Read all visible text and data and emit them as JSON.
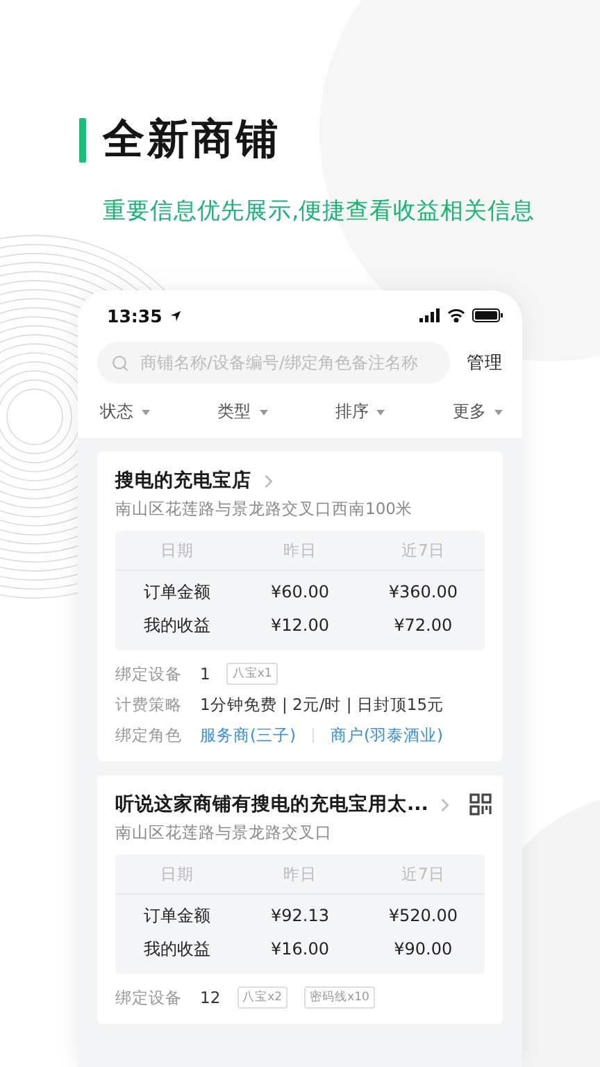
{
  "headline": {
    "title": "全新商铺",
    "subtitle": "重要信息优先展示,便捷查看收益相关信息"
  },
  "phone": {
    "status_bar": {
      "time": "13:35"
    },
    "search": {
      "placeholder": "商铺名称/设备编号/绑定角色备注名称"
    },
    "manage_button": "管理",
    "filters": [
      "状态",
      "类型",
      "排序",
      "更多"
    ],
    "stores": [
      {
        "name": "搜电的充电宝店",
        "qr_code": false,
        "address": "南山区花莲路与景龙路交叉口西南100米",
        "table": {
          "columns": [
            "日期",
            "昨日",
            "近7日"
          ],
          "rows": [
            [
              "订单金额",
              "¥60.00",
              "¥360.00"
            ],
            [
              "我的收益",
              "¥12.00",
              "¥72.00"
            ]
          ]
        },
        "details": [
          {
            "kind": "devices",
            "label": "绑定设备",
            "value": "1",
            "tags": [
              "八宝x1"
            ]
          },
          {
            "kind": "text",
            "label": "计费策略",
            "value": "1分钟免费 | 2元/时 | 日封顶15元"
          },
          {
            "kind": "roles",
            "label": "绑定角色",
            "links": [
              "服务商(三子)",
              "商户(羽泰酒业)"
            ]
          }
        ]
      },
      {
        "name": "听说这家商铺有搜电的充电宝用太...",
        "qr_code": true,
        "address": "南山区花莲路与景龙路交叉口",
        "table": {
          "columns": [
            "日期",
            "昨日",
            "近7日"
          ],
          "rows": [
            [
              "订单金额",
              "¥92.13",
              "¥520.00"
            ],
            [
              "我的收益",
              "¥16.00",
              "¥90.00"
            ]
          ]
        },
        "details": [
          {
            "kind": "devices",
            "label": "绑定设备",
            "value": "12",
            "tags": [
              "八宝x2",
              "密码线x10"
            ]
          }
        ]
      }
    ]
  }
}
